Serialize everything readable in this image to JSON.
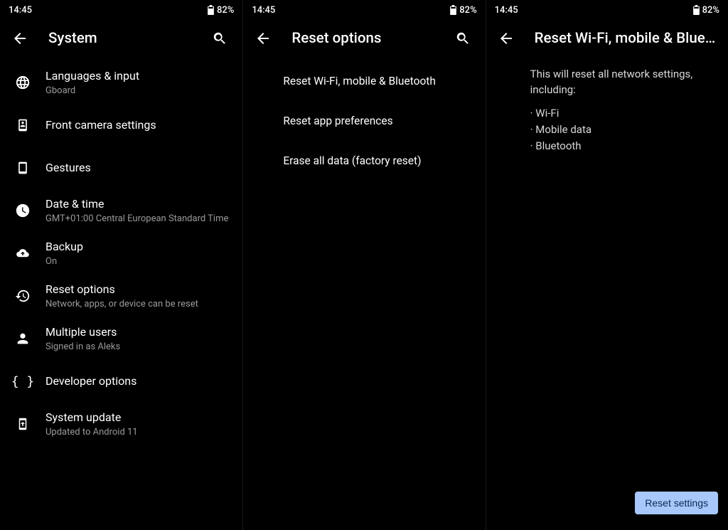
{
  "status": {
    "time": "14:45",
    "battery": "82%"
  },
  "panel1": {
    "title": "System",
    "items": [
      {
        "title": "Languages & input",
        "sub": "Gboard"
      },
      {
        "title": "Front camera settings",
        "sub": ""
      },
      {
        "title": "Gestures",
        "sub": ""
      },
      {
        "title": "Date & time",
        "sub": "GMT+01:00 Central European Standard Time"
      },
      {
        "title": "Backup",
        "sub": "On"
      },
      {
        "title": "Reset options",
        "sub": "Network, apps, or device can be reset"
      },
      {
        "title": "Multiple users",
        "sub": "Signed in as Aleks"
      },
      {
        "title": "Developer options",
        "sub": ""
      },
      {
        "title": "System update",
        "sub": "Updated to Android 11"
      }
    ]
  },
  "panel2": {
    "title": "Reset options",
    "items": [
      "Reset Wi-Fi, mobile & Bluetooth",
      "Reset app preferences",
      "Erase all data (factory reset)"
    ]
  },
  "panel3": {
    "title": "Reset Wi-Fi, mobile & Blueto…",
    "intro": "This will reset all network settings, including:",
    "bullets": [
      "Wi-Fi",
      "Mobile data",
      "Bluetooth"
    ],
    "button": "Reset settings"
  }
}
